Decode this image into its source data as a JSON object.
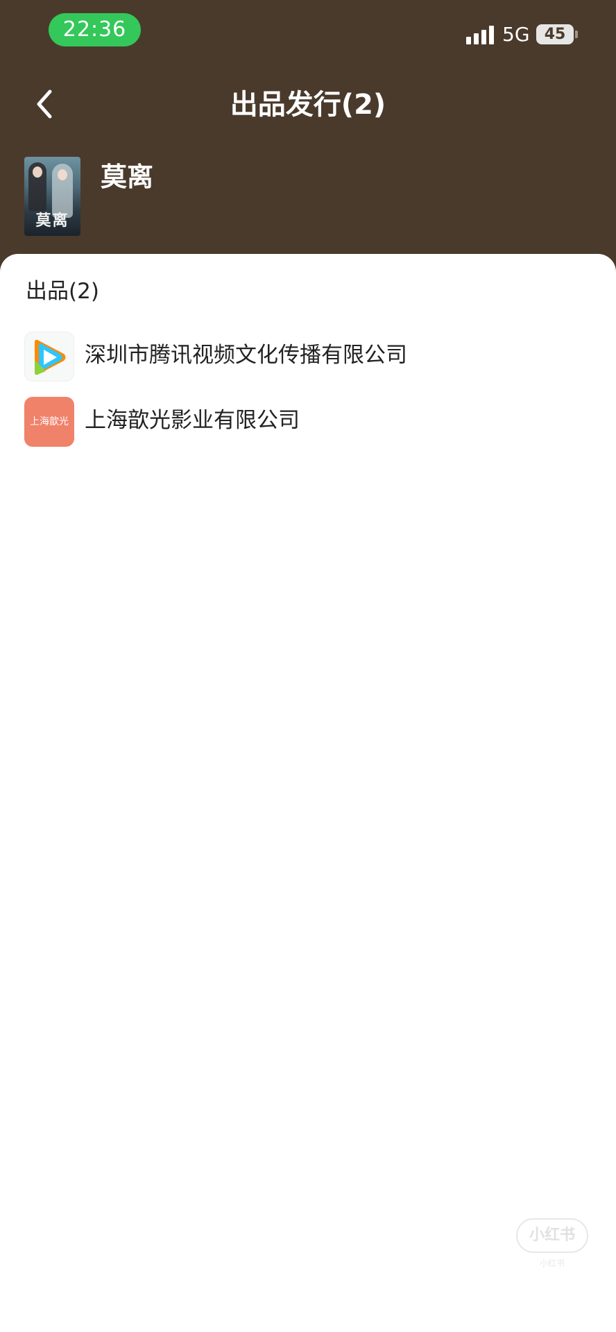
{
  "status_bar": {
    "time": "22:36",
    "network": "5G",
    "battery": "45"
  },
  "nav": {
    "title": "出品发行(2)",
    "back_icon": "chevron-left-icon"
  },
  "show": {
    "title": "莫离",
    "poster_caption": "莫离"
  },
  "production": {
    "heading": "出品(2)",
    "companies": [
      {
        "name": "深圳市腾讯视频文化传播有限公司",
        "logo": "tencent-video-logo-icon"
      },
      {
        "name": "上海歆光影业有限公司",
        "logo": "上海歆光"
      }
    ]
  },
  "watermark": {
    "main": "小红书",
    "sub": "小红书"
  },
  "colors": {
    "header_bg": "#4a3a2c",
    "time_pill": "#34c759",
    "logo_coral": "#f0826a"
  }
}
